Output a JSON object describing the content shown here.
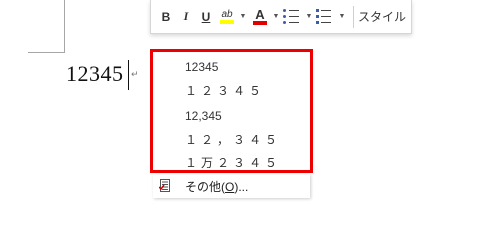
{
  "document": {
    "text": "12345",
    "paragraph_mark": "↵"
  },
  "toolbar": {
    "bold": "B",
    "italic": "I",
    "underline": "U",
    "highlight_glyph": "ab",
    "font_color_glyph": "A",
    "highlight_color": "#ffff00",
    "font_color": "#e00000",
    "styles_label": "スタイル"
  },
  "number_formats": {
    "items": [
      "12345",
      "１２３４５",
      "12,345",
      "１２，３４５",
      "１万２３４５"
    ]
  },
  "more_item": {
    "prefix": "その他(",
    "accel": "O",
    "suffix": ")..."
  },
  "colors": {
    "highlight_border": "#ee0000"
  }
}
